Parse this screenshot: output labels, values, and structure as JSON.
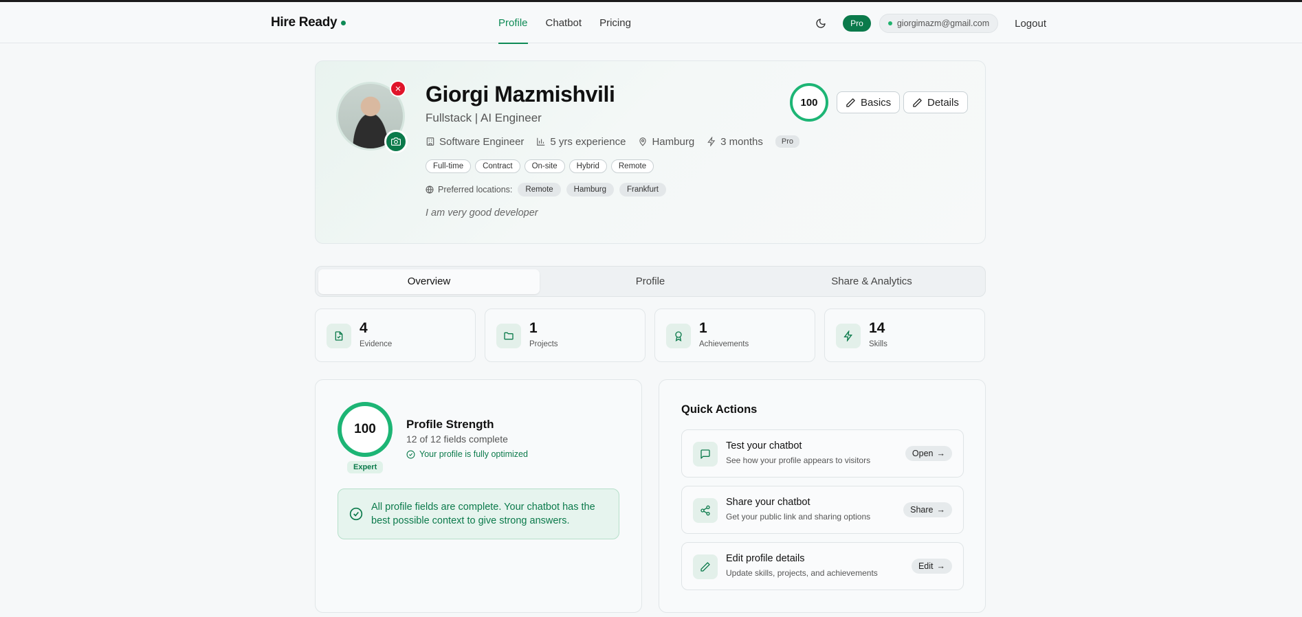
{
  "nav": {
    "brand": "Hire Ready",
    "links": [
      "Profile",
      "Chatbot",
      "Pricing"
    ],
    "plan": "Pro",
    "email": "giorgimazm@gmail.com",
    "logout": "Logout",
    "icons": {
      "theme": "moon-icon"
    }
  },
  "profile": {
    "name": "Giorgi Mazmishvili",
    "headline": "Fullstack | AI Engineer",
    "role": "Software Engineer",
    "experience": "5 yrs experience",
    "location": "Hamburg",
    "availability": "3 months",
    "plan_tag": "Pro",
    "work_types": [
      "Full-time",
      "Contract",
      "On-site",
      "Hybrid",
      "Remote"
    ],
    "preferred_label": "Preferred locations:",
    "preferred_locations": [
      "Remote",
      "Hamburg",
      "Frankfurt"
    ],
    "bio": "I am very good developer",
    "score": "100",
    "basics_button": "Basics",
    "details_button": "Details"
  },
  "tabs": [
    "Overview",
    "Profile",
    "Share & Analytics"
  ],
  "stats": [
    {
      "value": "4",
      "label": "Evidence",
      "icon": "file-icon"
    },
    {
      "value": "1",
      "label": "Projects",
      "icon": "folder-icon"
    },
    {
      "value": "1",
      "label": "Achievements",
      "icon": "award-icon"
    },
    {
      "value": "14",
      "label": "Skills",
      "icon": "bolt-icon"
    }
  ],
  "strength": {
    "score": "100",
    "level": "Expert",
    "title": "Profile Strength",
    "fields": "12 of 12 fields complete",
    "status": "Your profile is fully optimized",
    "message": "All profile fields are complete. Your chatbot has the best possible context to give strong answers."
  },
  "quick_actions": {
    "title": "Quick Actions",
    "items": [
      {
        "title": "Test your chatbot",
        "desc": "See how your profile appears to visitors",
        "button": "Open"
      },
      {
        "title": "Share your chatbot",
        "desc": "Get your public link and sharing options",
        "button": "Share"
      },
      {
        "title": "Edit profile details",
        "desc": "Update skills, projects, and achievements",
        "button": "Edit"
      }
    ]
  },
  "colors": {
    "accent": "#0b7a4b",
    "ring": "#1db575",
    "danger": "#e0142a"
  }
}
